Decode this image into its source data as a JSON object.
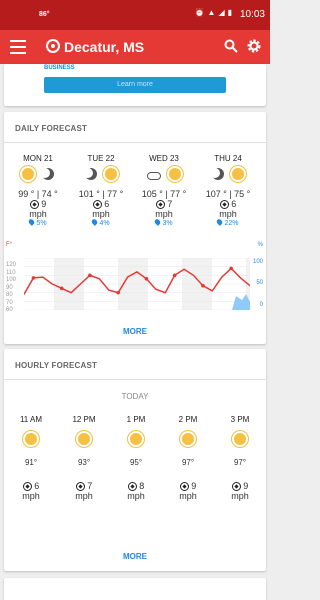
{
  "status": {
    "temp": "86°",
    "time": "10:03"
  },
  "app": {
    "location": "Decatur, MS"
  },
  "promo": {
    "tag": "BUSINESS",
    "learn_more": "Learn more"
  },
  "daily": {
    "title": "DAILY FORECAST",
    "days": [
      {
        "name": "MON 21",
        "temps": "99 ° | 74 °",
        "wind": "9",
        "unit": "mph",
        "precip": "5%"
      },
      {
        "name": "TUE 22",
        "temps": "101 ° | 77 °",
        "wind": "6",
        "unit": "mph",
        "precip": "4%"
      },
      {
        "name": "WED 23",
        "temps": "105 ° | 77 °",
        "wind": "7",
        "unit": "mph",
        "precip": "3%"
      },
      {
        "name": "THU 24",
        "temps": "107 ° | 75 °",
        "wind": "6",
        "unit": "mph",
        "precip": "22%"
      }
    ],
    "f_label": "F°",
    "pct_label": "%",
    "y_ticks": [
      "120",
      "110",
      "100",
      "90",
      "80",
      "70",
      "60"
    ],
    "right_ticks": [
      "100",
      "50",
      "0"
    ],
    "more": "MORE",
    "temperature_profile": [
      78,
      97,
      98,
      90,
      85,
      80,
      90,
      100,
      96,
      83,
      80,
      98,
      104,
      96,
      84,
      80,
      100,
      107,
      100,
      88,
      82,
      98,
      108,
      97,
      88
    ]
  },
  "hourly": {
    "title": "HOURLY FORECAST",
    "today": "TODAY",
    "hours": [
      {
        "time": "11 AM",
        "temp": "91°",
        "wind": "6",
        "unit": "mph"
      },
      {
        "time": "12 PM",
        "temp": "93°",
        "wind": "7",
        "unit": "mph"
      },
      {
        "time": "1 PM",
        "temp": "95°",
        "wind": "8",
        "unit": "mph"
      },
      {
        "time": "2 PM",
        "temp": "97°",
        "wind": "9",
        "unit": "mph"
      },
      {
        "time": "3 PM",
        "temp": "97°",
        "wind": "9",
        "unit": "mph"
      }
    ],
    "more": "MORE"
  },
  "colors": {
    "statusbar": "#b71c1c",
    "appbar": "#e53935",
    "accent": "#1e88e5",
    "temp_line": "#e53935",
    "sun": "#f6c042"
  }
}
